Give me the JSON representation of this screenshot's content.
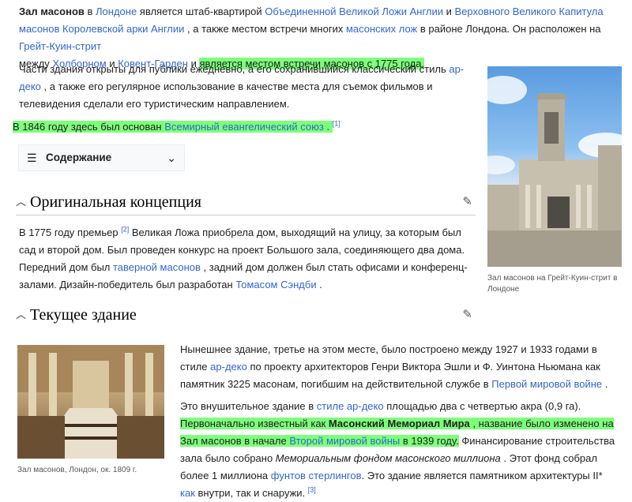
{
  "intro": {
    "p1": "Зал масонов",
    "p2": " в ",
    "p3": "Лондоне",
    "p4": " является штаб-квартирой ",
    "p5": "Объединенной Великой Ложи Англии",
    "p6": " и ",
    "p7": "Верховного Великого Капитула масонов Королевской арки Англии",
    "p8": " , а также местом встречи многих ",
    "p9": "масонских лож",
    "p10": " в районе Лондона. Он расположен на ",
    "p11": "Грейт-Куин-стрит",
    "p12": " между ",
    "p13": "Холборном",
    "p14": " и ",
    "p15": "Ковент-Гарден",
    "p16": " и ",
    "p17": "является местом встречи масонов с 1775 года."
  },
  "para2": {
    "p1": "Части здания открыты для публики ежедневно, а его сохранившийся классический стиль ",
    "p2": "ар-деко",
    "p3": " , а также его регулярное использование в качестве места для съемок фильмов и телевидения сделали его туристическим направлением."
  },
  "para3": {
    "p1": "В 1846 году здесь был основан ",
    "p2": "Всемирный евангелический союз",
    "p3": " . ",
    "ref": "[1]"
  },
  "toc": {
    "label": "Содержание"
  },
  "section1": {
    "title": "Оригинальная концепция",
    "p1": "В 1775 году премьер ",
    "ref": "[2]",
    "p2": " Великая Ложа приобрела дом, выходящий на улицу, за которым был сад и второй дом. Был проведен конкурс на проект Большого зала, соединяющего два дома. Передний дом был ",
    "p3": "таверной масонов",
    "p4": " , задний дом должен был стать офисами и конференц-залами. Дизайн-победитель был разработан ",
    "p5": "Томасом Сэндби",
    "p6": " ."
  },
  "section2": {
    "title": "Текущее здание",
    "a1": "Нынешнее здание, третье на этом месте, было построено между 1927 и 1933 годами в стиле ",
    "a2": "ар-деко",
    "a3": " по проекту архитекторов Генри Виктора Эшли и Ф. Уинтона Ньюмана как памятник 3225 масонам, погибшим на действительной службе в ",
    "a4": "Первой мировой войне",
    "a5": " .",
    "b1": "Это внушительное здание в ",
    "b2": "стиле ар-деко",
    "b3": " площадью два с четвертью акра (0,9 га).",
    "b4": "Первоначально известный как ",
    "b5": "Масонский Мемориал Мира",
    "b6": " , название было изменено на Зал масонов в начале ",
    "b7": "Второй мировой войны",
    "b8": " в 1939 году.",
    "b9": " Финансирование строительства зала было собрано ",
    "b10": "Мемориальным фондом масонского миллиона",
    "b11": " . Этот фонд собрал более 1 миллиона ",
    "b12": "фунтов стерлингов",
    "b13": ". Это здание является памятником архитектуры II* ",
    "b14": "как",
    "b15": " внутри, так и снаружи. ",
    "ref": "[3]"
  },
  "figure1": {
    "caption": "Зал масонов на Грейт-Куин-стрит в Лондоне"
  },
  "figure2": {
    "caption": "Зал масонов, Лондон, ок. 1809 г."
  },
  "icons": {
    "toc": "list-icon",
    "chevron_down": "chevron-down-icon",
    "chevron_up": "chevron-up-icon",
    "edit": "pencil-icon"
  },
  "colors": {
    "link": "#3366cc",
    "highlight": "#7dff7a",
    "text": "#202122"
  }
}
